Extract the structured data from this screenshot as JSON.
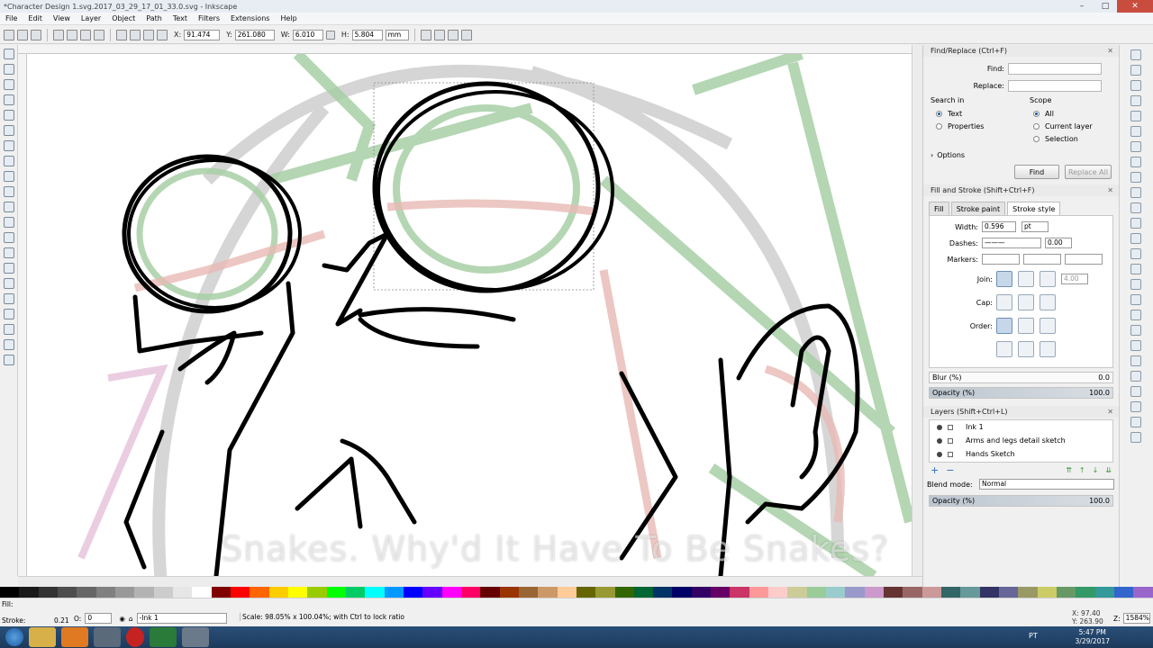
{
  "window": {
    "title": "*Character Design 1.svg.2017_03_29_17_01_33.0.svg - Inkscape"
  },
  "menu": [
    "File",
    "Edit",
    "View",
    "Layer",
    "Object",
    "Path",
    "Text",
    "Filters",
    "Extensions",
    "Help"
  ],
  "toolbar": {
    "x_label": "X:",
    "x_value": "91.474",
    "y_label": "Y:",
    "y_value": "261.080",
    "w_label": "W:",
    "w_value": "6.010",
    "h_label": "H:",
    "h_value": "5.804",
    "unit": "mm"
  },
  "caption": "Snakes. Why'd It Have To Be Snakes?",
  "find_replace": {
    "title": "Find/Replace (Ctrl+F)",
    "find_label": "Find:",
    "replace_label": "Replace:",
    "search_in_label": "Search in",
    "search_in": [
      "Text",
      "Properties"
    ],
    "scope_label": "Scope",
    "scope": [
      "All",
      "Current layer",
      "Selection"
    ],
    "options_label": "Options",
    "find_button": "Find",
    "replace_all_button": "Replace All"
  },
  "fill_stroke": {
    "title": "Fill and Stroke (Shift+Ctrl+F)",
    "tabs": [
      "Fill",
      "Stroke paint",
      "Stroke style"
    ],
    "width_label": "Width:",
    "width_value": "0.596",
    "width_unit": "pt",
    "dashes_label": "Dashes:",
    "dashes_value": "0.00",
    "markers_label": "Markers:",
    "join_label": "Join:",
    "join_limit": "4.00",
    "cap_label": "Cap:",
    "order_label": "Order:",
    "blur_label": "Blur (%)",
    "blur_value": "0.0",
    "opacity_label": "Opacity (%)",
    "opacity_value": "100.0"
  },
  "layers": {
    "title": "Layers (Shift+Ctrl+L)",
    "items": [
      "Ink 1",
      "Arms and legs detail sketch",
      "Hands Sketch"
    ],
    "blend_label": "Blend mode:",
    "blend_value": "Normal",
    "opacity_label": "Opacity (%)",
    "opacity_value": "100.0"
  },
  "status": {
    "fill_label": "Fill:",
    "stroke_label": "Stroke:",
    "stroke_value": "0.21",
    "o_label": "O:",
    "o_value": "0",
    "layer": "-Ink 1",
    "message": "Scale: 98.05% x 100.04%; with Ctrl to lock ratio",
    "coords_x": "X: 97.40",
    "coords_y": "Y: 263.90",
    "z_label": "Z:",
    "zoom": "1584%"
  },
  "taskbar": {
    "lang": "PT",
    "time": "5:47 PM",
    "date": "3/29/2017"
  },
  "palette_colors": [
    "#000000",
    "#1a1a1a",
    "#333333",
    "#4d4d4d",
    "#666666",
    "#808080",
    "#999999",
    "#b3b3b3",
    "#cccccc",
    "#e6e6e6",
    "#ffffff",
    "#800000",
    "#ff0000",
    "#ff6600",
    "#ffcc00",
    "#ffff00",
    "#99cc00",
    "#00ff00",
    "#00cc66",
    "#00ffff",
    "#0099ff",
    "#0000ff",
    "#6600ff",
    "#ff00ff",
    "#ff0066",
    "#660000",
    "#993300",
    "#996633",
    "#cc9966",
    "#ffcc99",
    "#666600",
    "#999933",
    "#336600",
    "#006633",
    "#003366",
    "#000066",
    "#330066",
    "#660066",
    "#cc3366",
    "#ff9999",
    "#ffcccc",
    "#cccc99",
    "#99cc99",
    "#99cccc",
    "#9999cc",
    "#cc99cc",
    "#663333",
    "#996666",
    "#cc9999",
    "#336666",
    "#669999",
    "#333366",
    "#666699",
    "#999966",
    "#cccc66",
    "#669966",
    "#339966",
    "#339999",
    "#3366cc",
    "#9966cc"
  ]
}
